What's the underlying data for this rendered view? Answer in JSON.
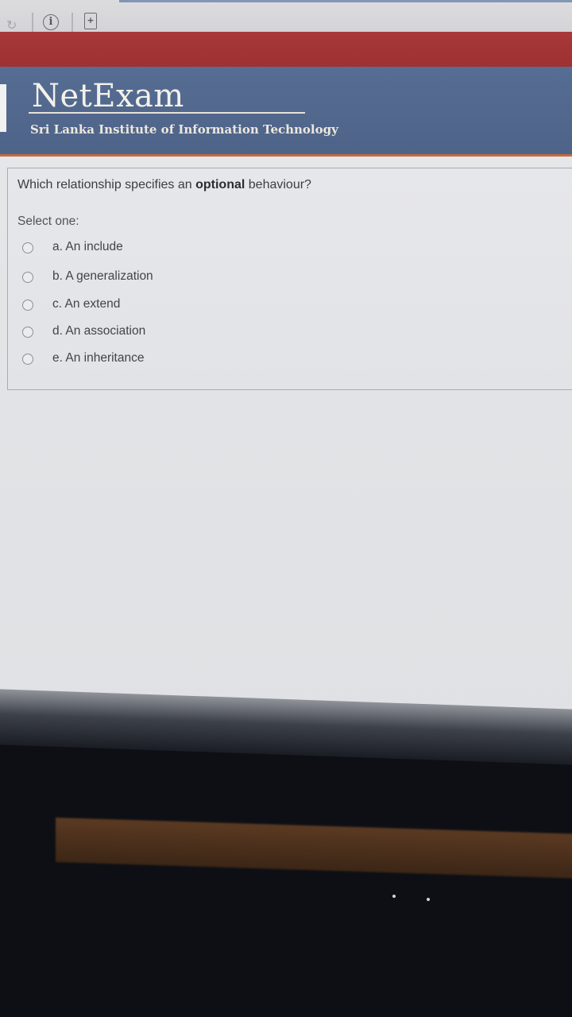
{
  "browser": {
    "icons": [
      "reload-icon",
      "info-icon",
      "page-icon"
    ],
    "info_glyph": "i",
    "page_glyph": "+"
  },
  "header": {
    "logo": "NetExam",
    "institute": "Sri Lanka Institute of Information Technology",
    "colors": {
      "red_band": "#a8383a",
      "blue_band": "#566d93"
    }
  },
  "quiz": {
    "question_prefix": "Which relationship specifies an ",
    "question_emphasis": "optional",
    "question_suffix": " behaviour?",
    "select_label": "Select one:",
    "options": [
      {
        "label": "a. An include",
        "selected": false
      },
      {
        "label": "b. A generalization",
        "selected": false
      },
      {
        "label": "c. An extend",
        "selected": false
      },
      {
        "label": "d. An association",
        "selected": false
      },
      {
        "label": "e. An inheritance",
        "selected": false
      }
    ]
  }
}
